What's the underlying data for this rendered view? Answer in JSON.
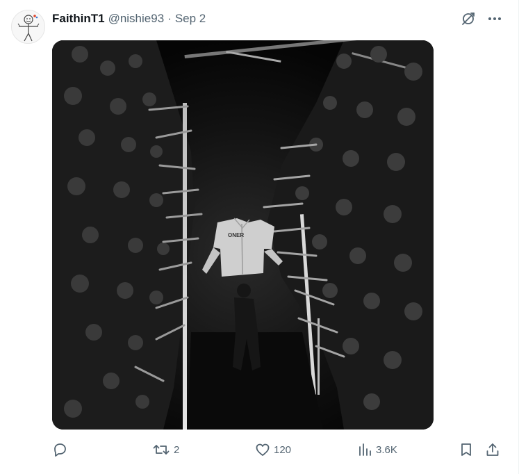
{
  "tweet": {
    "display_name": "FaithinT1",
    "handle": "@nishie93",
    "separator": "·",
    "date": "Sep 2",
    "media": {
      "jacket_text": "ONER"
    }
  },
  "top_actions": {
    "grok_icon": "grok-icon",
    "more_icon": "more-icon"
  },
  "actions": {
    "reply_count": "",
    "retweet_count": "2",
    "like_count": "120",
    "view_count": "3.6K"
  },
  "colors": {
    "text_primary": "#0f1419",
    "text_secondary": "#536471",
    "border": "#eff3f4"
  }
}
